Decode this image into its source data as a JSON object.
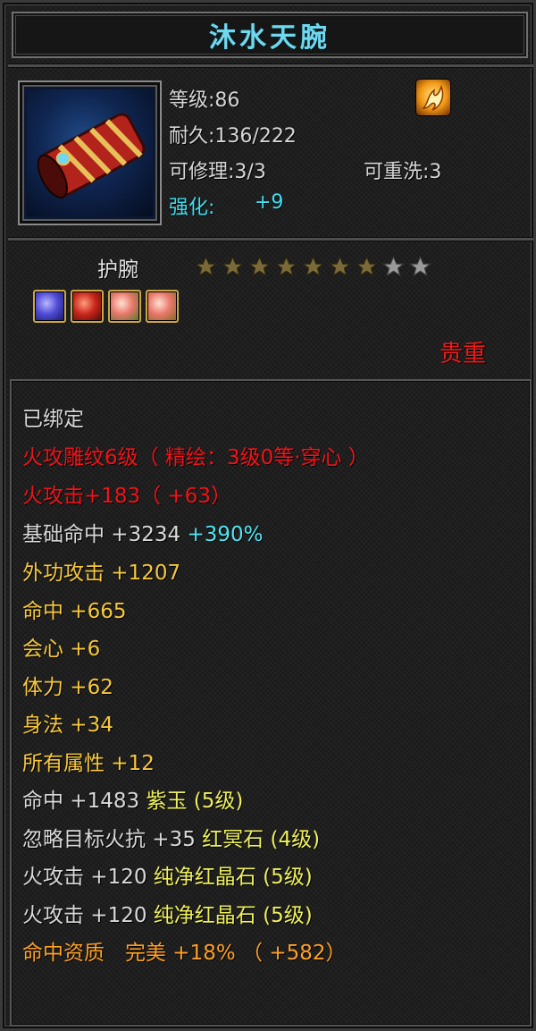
{
  "title": "沐水天腕",
  "info": {
    "level": "等级:86",
    "durability": "耐久:136/222",
    "repair": "可修理:3/3",
    "rewash": "可重洗:3",
    "enhance_label": "强化:",
    "enhance_value": "+9"
  },
  "item_icon": "red-gold-bracer-icon",
  "corner_icon": "fire-element-icon",
  "type": "护腕",
  "stars": {
    "filled": 7,
    "total": 9,
    "filled_color": "#7a6a38",
    "empty_color": "#9a9a9a"
  },
  "gems": [
    {
      "icon": "purple-jade-gem-icon",
      "color": "#5b56e0"
    },
    {
      "icon": "red-dark-stone-gem-icon",
      "color": "#c8261a"
    },
    {
      "icon": "pure-red-crystal-gem-icon",
      "color": "#e8776a"
    },
    {
      "icon": "pure-red-crystal-gem-icon",
      "color": "#e8776a"
    }
  ],
  "quality": "贵重",
  "attributes": {
    "bound": "已绑定",
    "engrave": "火攻雕纹6级（ 精绘：3级0等·穿心 ）",
    "fire_attack": "火攻击+183（ +63）",
    "base_hit": "基础命中 +3234",
    "base_hit_pct": "+390%",
    "outer_attack": "外功攻击 +1207",
    "hit": "命中 +665",
    "crit": "会心 +6",
    "stamina": "体力 +62",
    "agility": "身法 +34",
    "all_attr": "所有属性 +12",
    "gem1_stat": "命中 +1483",
    "gem1_name": "紫玉 (5级)",
    "gem2_stat": "忽略目标火抗 +35",
    "gem2_name": "红冥石 (4级)",
    "gem3_stat": "火攻击 +120",
    "gem3_name": "纯净红晶石 (5级)",
    "gem4_stat": "火攻击 +120",
    "gem4_name": "纯净红晶石 (5级)",
    "aptitude": "命中资质　完美 +18% （ +582）"
  },
  "colors": {
    "title": "#6fd8ee",
    "red": "#f0141a",
    "yellow": "#f7c83b",
    "lime": "#eef05a",
    "cyan": "#4fe6f2",
    "orange": "#ffa124",
    "quality": "#ee1b1b"
  }
}
